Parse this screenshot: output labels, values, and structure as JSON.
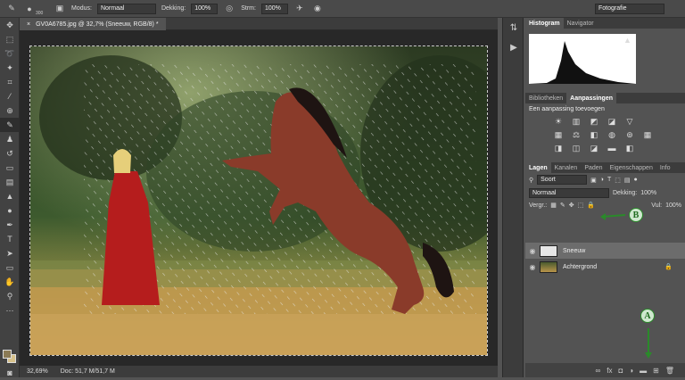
{
  "options_bar": {
    "brush_size": "300",
    "mode_label": "Modus:",
    "mode_value": "Normaal",
    "opacity_label": "Dekking:",
    "opacity_value": "100%",
    "flow_label": "Strm:",
    "flow_value": "100%",
    "workspace": "Fotografie"
  },
  "document": {
    "tab_title": "GV0A6785.jpg @ 32,7% (Sneeuw, RGB/8) *",
    "close_glyph": "×"
  },
  "status_bar": {
    "zoom": "32,69%",
    "doc_info": "Doc: 51,7 M/51,7 M"
  },
  "top_panel": {
    "tabs": [
      "Histogram",
      "Navigator"
    ]
  },
  "adjust_panel": {
    "tabs": [
      "Bibliotheken",
      "Aanpassingen"
    ],
    "title": "Een aanpassing toevoegen"
  },
  "layers_panel": {
    "tabs": [
      "Lagen",
      "Kanalen",
      "Paden",
      "Eigenschappen",
      "Info"
    ],
    "filter_kind": "Soort",
    "blend_mode": "Normaal",
    "opacity_label": "Dekking:",
    "opacity_value": "100%",
    "lock_label": "Vergr.:",
    "fill_label": "Vul:",
    "fill_value": "100%",
    "layers": [
      {
        "name": "Sneeuw"
      },
      {
        "name": "Achtergrond"
      }
    ]
  },
  "annotations": {
    "marker_a": "A",
    "marker_b": "B",
    "marker_color": "#2a8a2a"
  },
  "colors": {
    "foreground": "#8a7a55",
    "background": "#d7c28b"
  }
}
